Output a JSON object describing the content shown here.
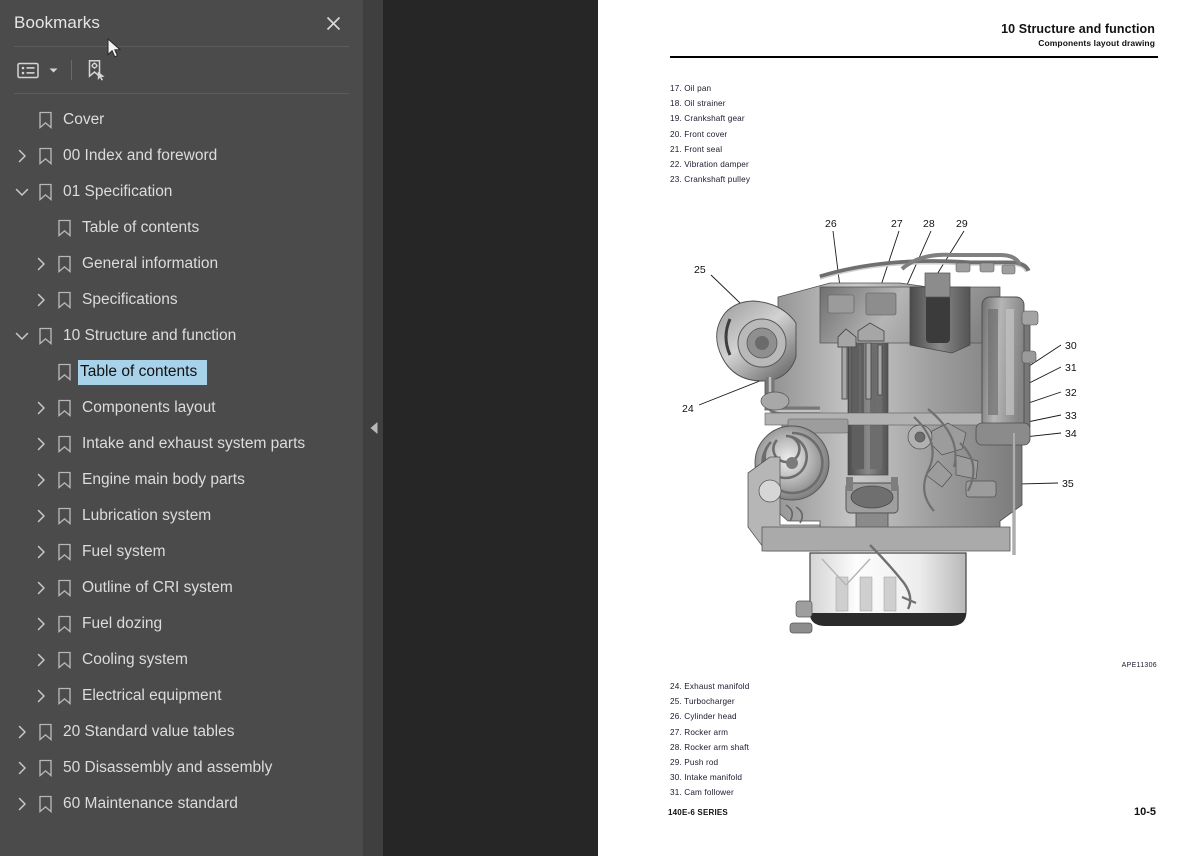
{
  "sidebar": {
    "title": "Bookmarks",
    "close_icon": "close-icon",
    "toolbar": {
      "list_options_icon": "list-view-icon",
      "caret_icon": "chevron-down-icon",
      "new_bookmark_icon": "new-bookmark-icon"
    },
    "items": [
      {
        "label": "Cover",
        "depth": 0,
        "chevron": "none",
        "selected": false
      },
      {
        "label": "00 Index and foreword",
        "depth": 0,
        "chevron": "collapsed",
        "selected": false
      },
      {
        "label": "01 Specification",
        "depth": 0,
        "chevron": "expanded",
        "selected": false
      },
      {
        "label": "Table of contents",
        "depth": 1,
        "chevron": "none",
        "selected": false
      },
      {
        "label": "General information",
        "depth": 1,
        "chevron": "collapsed",
        "selected": false
      },
      {
        "label": "Specifications",
        "depth": 1,
        "chevron": "collapsed",
        "selected": false
      },
      {
        "label": "10 Structure and function",
        "depth": 0,
        "chevron": "expanded",
        "selected": false
      },
      {
        "label": "Table of contents",
        "depth": 1,
        "chevron": "none",
        "selected": true
      },
      {
        "label": "Components layout",
        "depth": 1,
        "chevron": "collapsed",
        "selected": false
      },
      {
        "label": "Intake and exhaust system parts",
        "depth": 1,
        "chevron": "collapsed",
        "selected": false
      },
      {
        "label": "Engine main body parts",
        "depth": 1,
        "chevron": "collapsed",
        "selected": false
      },
      {
        "label": "Lubrication system",
        "depth": 1,
        "chevron": "collapsed",
        "selected": false
      },
      {
        "label": "Fuel system",
        "depth": 1,
        "chevron": "collapsed",
        "selected": false
      },
      {
        "label": "Outline of CRI system",
        "depth": 1,
        "chevron": "collapsed",
        "selected": false
      },
      {
        "label": "Fuel dozing",
        "depth": 1,
        "chevron": "collapsed",
        "selected": false
      },
      {
        "label": "Cooling system",
        "depth": 1,
        "chevron": "collapsed",
        "selected": false
      },
      {
        "label": "Electrical equipment",
        "depth": 1,
        "chevron": "collapsed",
        "selected": false
      },
      {
        "label": "20 Standard value tables",
        "depth": 0,
        "chevron": "collapsed",
        "selected": false
      },
      {
        "label": "50 Disassembly and assembly",
        "depth": 0,
        "chevron": "collapsed",
        "selected": false
      },
      {
        "label": "60 Maintenance standard",
        "depth": 0,
        "chevron": "collapsed",
        "selected": false
      }
    ],
    "collapse_handle_icon": "collapse-left-icon"
  },
  "page": {
    "header_title": "10 Structure and function",
    "header_subtitle": "Components layout drawing",
    "parts_top": [
      "17. Oil pan",
      "18. Oil strainer",
      "19. Crankshaft gear",
      "20. Front cover",
      "21. Front seal",
      "22. Vibration damper",
      "23. Crankshaft pulley"
    ],
    "parts_bottom": [
      "24. Exhaust manifold",
      "25. Turbocharger",
      "26. Cylinder head",
      "27. Rocker arm",
      "28. Rocker arm shaft",
      "29. Push rod",
      "30. Intake manifold",
      "31. Cam follower"
    ],
    "artwork_code": "APE11306",
    "footer_left": "140E-6 SERIES",
    "footer_right": "10-5",
    "figure": {
      "name": "engine-cutaway-drawing",
      "callouts": [
        "24",
        "25",
        "26",
        "27",
        "28",
        "29",
        "30",
        "31",
        "32",
        "33",
        "34",
        "35"
      ]
    }
  },
  "colors": {
    "sidebar_bg": "#4b4b4b",
    "strip_bg": "#3f3f3f",
    "viewer_bg": "#262626",
    "page_bg": "#ffffff",
    "selection": "#a8d2ea",
    "text": "#dcdcdc"
  }
}
